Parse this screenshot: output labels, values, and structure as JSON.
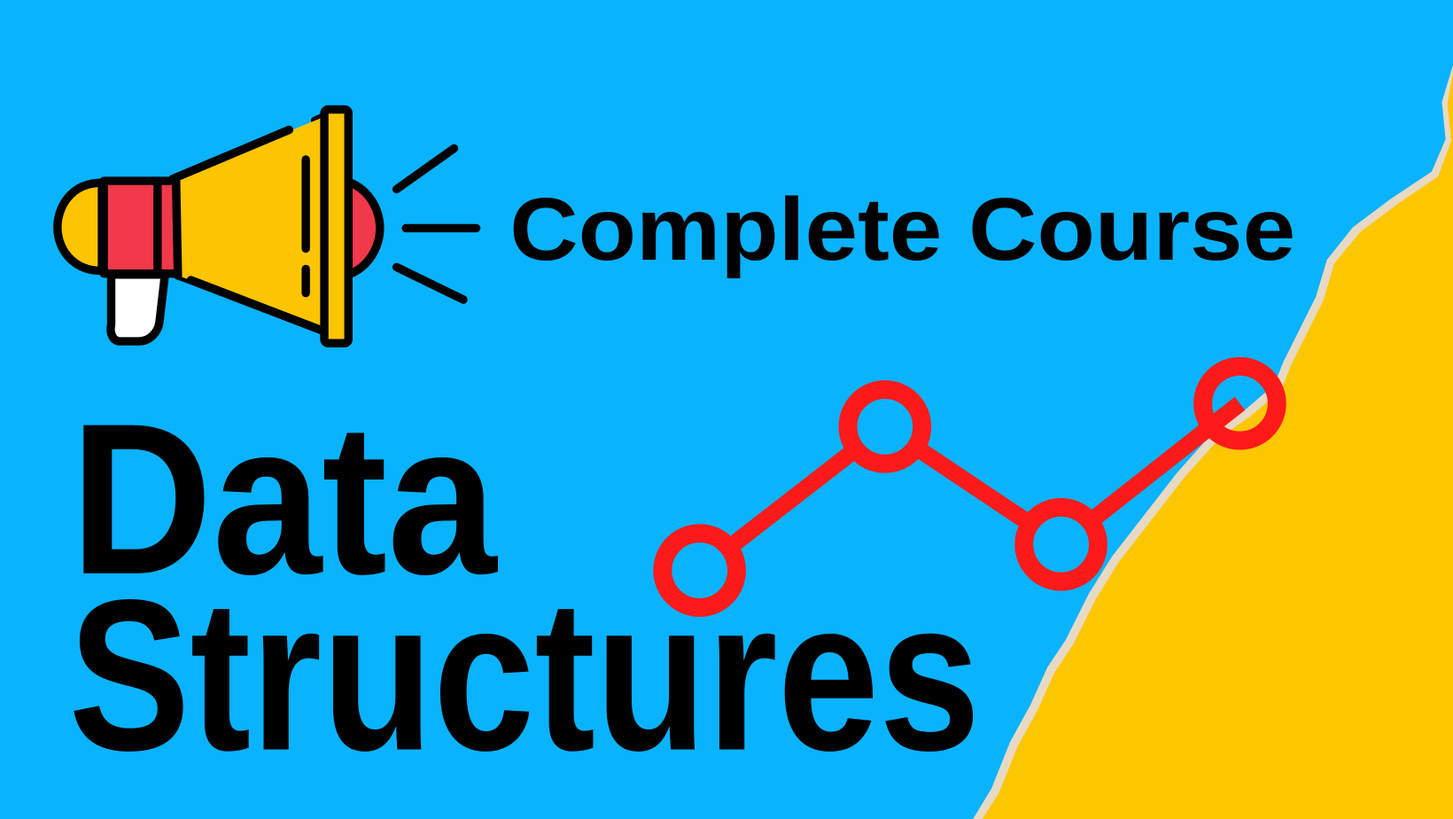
{
  "subtitle": "Complete Course",
  "title_line1": "Data",
  "title_line2": "Structures",
  "icons": [
    "megaphone-icon",
    "line-chart-icon"
  ],
  "colors": {
    "background": "#09b3fe",
    "paper": "#fdc700",
    "torn_edge": "#e8d9c4",
    "chart": "#ff1a1a",
    "megaphone_body": "#fdc400",
    "megaphone_band": "#f2384b",
    "text": "#000000"
  }
}
